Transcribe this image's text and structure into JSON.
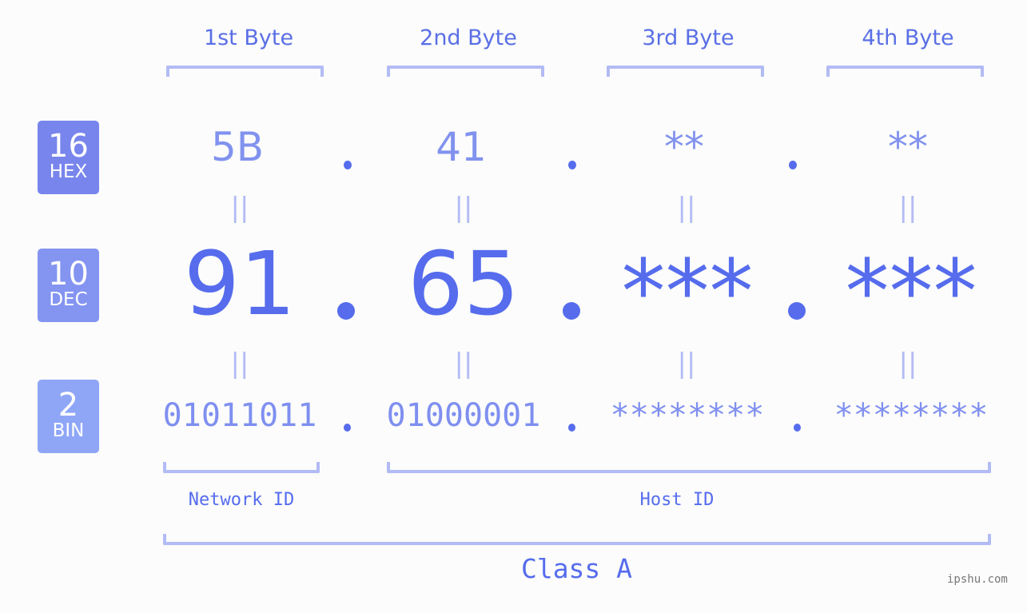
{
  "headers": [
    "1st Byte",
    "2nd Byte",
    "3rd Byte",
    "4th Byte"
  ],
  "badges": {
    "hex": {
      "num": "16",
      "label": "HEX",
      "color": "#7785ec"
    },
    "dec": {
      "num": "10",
      "label": "DEC",
      "color": "#8494f1"
    },
    "bin": {
      "num": "2",
      "label": "BIN",
      "color": "#8fa6f7"
    }
  },
  "hex": [
    "5B",
    "41",
    "**",
    "**"
  ],
  "dec": [
    "91",
    "65",
    "***",
    "***"
  ],
  "bin": [
    "01011011",
    "01000001",
    "********",
    "********"
  ],
  "equals_symbol": "||",
  "network_label": "Network ID",
  "host_label": "Host ID",
  "class_label": "Class A",
  "watermark": "ipshu.com",
  "colors": {
    "accent": "#566ced",
    "bracket": "#b3bbf5",
    "background": "#fbfcfb"
  }
}
